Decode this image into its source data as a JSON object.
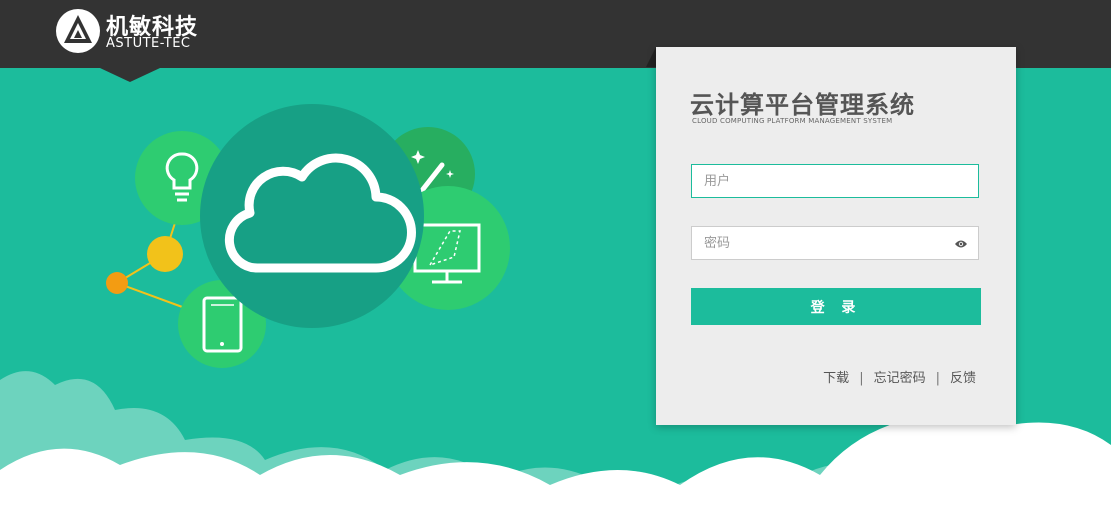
{
  "header": {
    "logo_cn": "机敏科技",
    "logo_en": "ASTUTE-TEC"
  },
  "login": {
    "title_cn": "云计算平台管理系统",
    "title_en": "CLOUD COMPUTING PLATFORM MANAGEMENT SYSTEM",
    "username_placeholder": "用户",
    "password_placeholder": "密码",
    "submit_label": "登 录"
  },
  "footer_links": {
    "download": "下载",
    "forgot_password": "忘记密码",
    "feedback": "反馈",
    "separator": "|"
  },
  "colors": {
    "background": "#1cbc9c",
    "topbar": "#333333",
    "accent": "#1cbc9c",
    "card": "#ededed"
  },
  "icons": [
    "logo-icon",
    "lightbulb-icon",
    "cloud-icon",
    "magic-wand-icon",
    "monitor-icon",
    "tablet-icon",
    "eye-icon"
  ]
}
